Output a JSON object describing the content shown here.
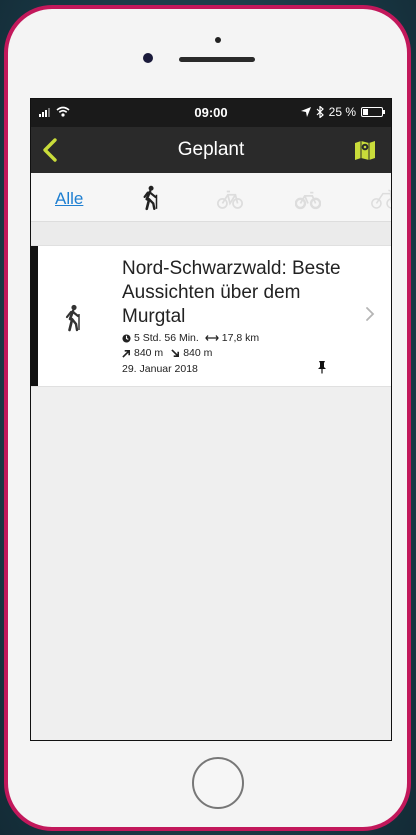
{
  "status_bar": {
    "time": "09:00",
    "battery": "25 %",
    "battery_level": 0.25
  },
  "nav": {
    "title": "Geplant",
    "back_icon": "chevron-left-icon",
    "map_icon": "map-icon",
    "accent": "#c9dc3a"
  },
  "filters": {
    "all_label": "Alle",
    "items": [
      "hiking-icon",
      "bike-icon",
      "mountain-bike-icon",
      "race-bike-icon"
    ]
  },
  "tour": {
    "title": "Nord-Schwarzwald: Beste Aussichten über dem Murgtal",
    "duration": "5 Std. 56 Min.",
    "distance": "17,8 km",
    "ascent": "840 m",
    "descent": "840 m",
    "date": "29. Januar 2018",
    "sport_icon": "hiking-icon"
  }
}
